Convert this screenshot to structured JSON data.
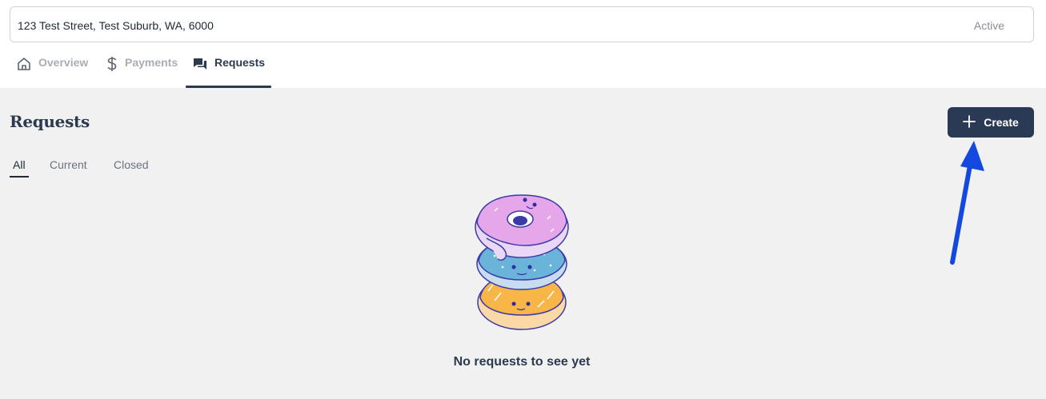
{
  "property": {
    "address": "123 Test Street, Test Suburb, WA, 6000",
    "status": "Active"
  },
  "nav_tabs": [
    {
      "label": "Overview",
      "icon": "home-icon",
      "active": false
    },
    {
      "label": "Payments",
      "icon": "dollar-icon",
      "active": false
    },
    {
      "label": "Requests",
      "icon": "chat-bubbles-icon",
      "active": true
    }
  ],
  "requests": {
    "title": "Requests",
    "create_label": "Create",
    "create_icon": "plus-icon",
    "filters": [
      {
        "label": "All",
        "active": true
      },
      {
        "label": "Current",
        "active": false
      },
      {
        "label": "Closed",
        "active": false
      }
    ],
    "empty_message": "No requests to see yet"
  },
  "colors": {
    "primary": "#2b3a54",
    "annotation_arrow": "#1449e0",
    "background": "#f1f1f1"
  }
}
